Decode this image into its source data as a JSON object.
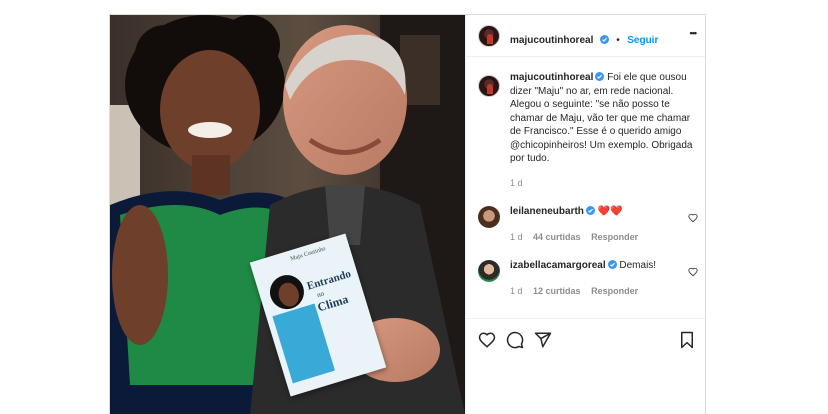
{
  "post": {
    "author": "majucoutinhoreal",
    "follow_label": "Seguir",
    "more_label": "•••",
    "separator": "•"
  },
  "caption": {
    "username": "majucoutinhoreal",
    "text": "Foi ele que ousou dizer \"Maju\" no ar, em rede nacional. Alegou o seguinte: \"se não posso te chamar de Maju, vão ter que me chamar de Francisco.\" Esse é o querido amigo @chicopinheiros! Um exemplo. Obrigada por tudo.",
    "time": "1 d"
  },
  "comments": [
    {
      "username": "leilaneneubarth",
      "text": "❤️❤️",
      "time": "1 d",
      "likes": "44 curtidas",
      "reply": "Responder"
    },
    {
      "username": "izabellacamargoreal",
      "text": "Demais!",
      "time": "1 d",
      "likes": "12 curtidas",
      "reply": "Responder"
    }
  ],
  "book": {
    "author": "Maju Coutinho",
    "title_line1": "Entrando",
    "title_line2": "no",
    "title_line3": "Clima"
  },
  "colors": {
    "accent": "#0095f6",
    "verified": "#3897f0",
    "heart_red": "#e0245e"
  },
  "icons": [
    "heart-icon",
    "comment-icon",
    "share-icon",
    "bookmark-icon",
    "more-icon",
    "verified-badge-icon"
  ]
}
